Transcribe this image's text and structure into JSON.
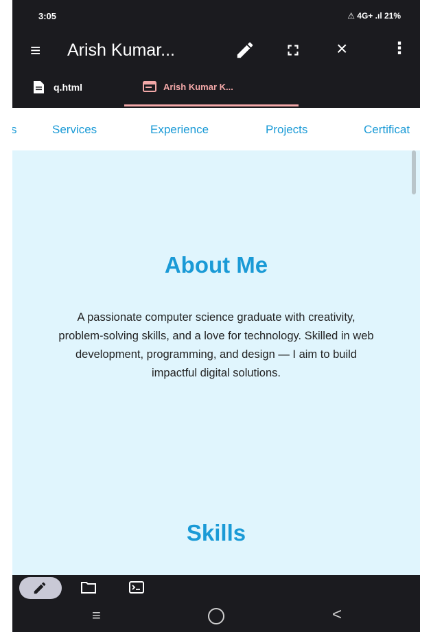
{
  "status": {
    "time": "3:05",
    "right_icons": "⚠ 4G+ .ıl 21%",
    "battery": "21%"
  },
  "appbar": {
    "title": "Arish Kumar..."
  },
  "tabs": [
    {
      "label": "q.html"
    },
    {
      "label": "Arish Kumar K..."
    }
  ],
  "nav": {
    "items": [
      "s",
      "Services",
      "Experience",
      "Projects",
      "Certificat"
    ]
  },
  "content": {
    "about_title": "About Me",
    "about_text": "A passionate computer science graduate with creativity, problem-solving skills, and a love for technology. Skilled in web development, programming, and design — I aim to build impactful digital solutions.",
    "skills_title": "Skills"
  },
  "colors": {
    "accent": "#1a9ad6",
    "page_bg": "#e0f5fd",
    "tab_active": "#f3a8a8",
    "chrome": "#1b1b1f"
  },
  "icons": {
    "menu": "menu-icon",
    "edit": "pencil-icon",
    "expand": "fullscreen-icon",
    "close": "close-icon",
    "more": "more-vert-icon",
    "file": "file-icon",
    "web": "browser-icon",
    "folder": "folder-icon",
    "terminal": "terminal-icon"
  }
}
